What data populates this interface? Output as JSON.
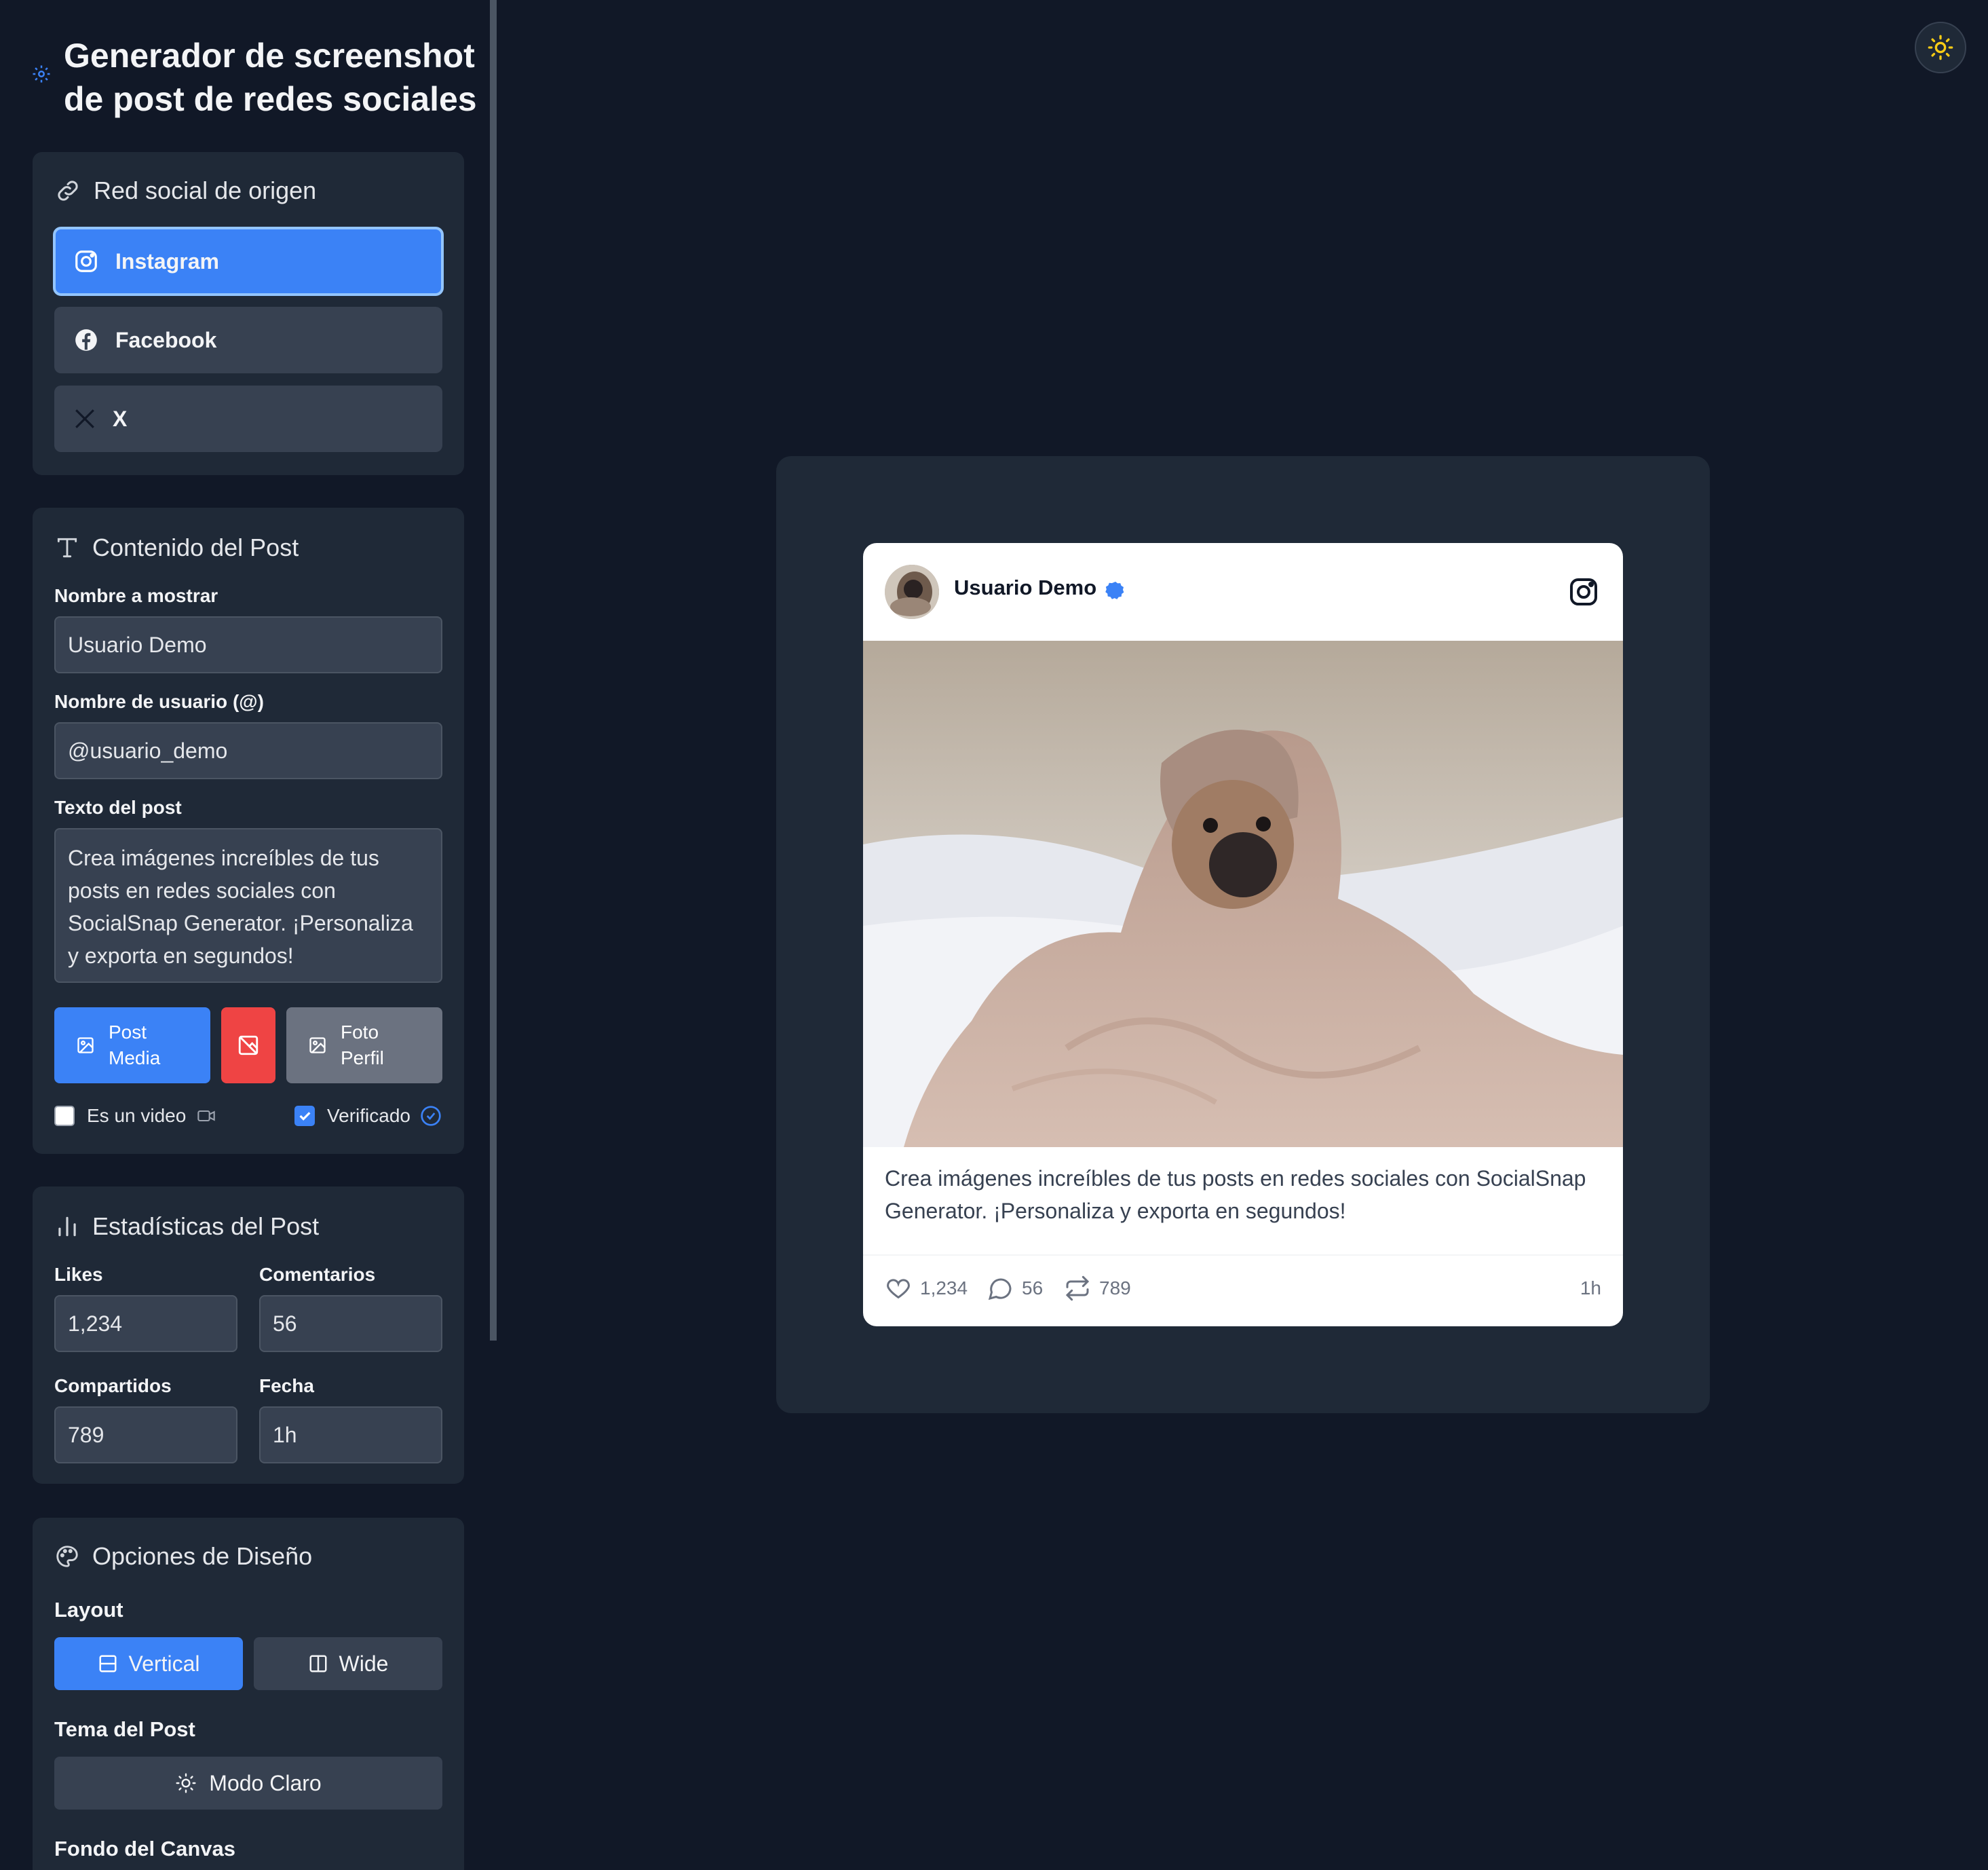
{
  "app": {
    "title": "Generador de screenshot de post de redes sociales"
  },
  "social_section": {
    "title": "Red social de origen",
    "options": [
      {
        "label": "Instagram",
        "icon": "instagram-icon",
        "selected": true
      },
      {
        "label": "Facebook",
        "icon": "facebook-icon",
        "selected": false
      },
      {
        "label": "X",
        "icon": "x-icon",
        "selected": false
      }
    ]
  },
  "content_section": {
    "title": "Contenido del Post",
    "display_name_label": "Nombre a mostrar",
    "display_name_value": "Usuario Demo",
    "username_label": "Nombre de usuario (@)",
    "username_value": "@usuario_demo",
    "text_label": "Texto del post",
    "text_value": "Crea imágenes increíbles de tus posts en redes sociales con SocialSnap Generator. ¡Personaliza y exporta en segundos!",
    "post_media_line1": "Post",
    "post_media_line2": "Media",
    "profile_photo_line1": "Foto",
    "profile_photo_line2": "Perfil",
    "is_video_label": "Es un video",
    "is_video_checked": false,
    "verified_label": "Verificado",
    "verified_checked": true
  },
  "stats_section": {
    "title": "Estadísticas del Post",
    "likes_label": "Likes",
    "likes_value": "1,234",
    "comments_label": "Comentarios",
    "comments_value": "56",
    "shares_label": "Compartidos",
    "shares_value": "789",
    "date_label": "Fecha",
    "date_value": "1h"
  },
  "design_section": {
    "title": "Opciones de Diseño",
    "layout_label": "Layout",
    "layout_vertical": "Vertical",
    "layout_wide": "Wide",
    "layout_selected": "Vertical",
    "theme_label": "Tema del Post",
    "theme_button": "Modo Claro",
    "canvas_bg_label": "Fondo del Canvas"
  },
  "preview": {
    "display_name": "Usuario Demo",
    "platform_icon": "instagram-icon",
    "text": "Crea imágenes increíbles de tus posts en redes sociales con SocialSnap Generator. ¡Personaliza y exporta en segundos!",
    "likes": "1,234",
    "comments": "56",
    "shares": "789",
    "date": "1h"
  },
  "colors": {
    "background": "#111827",
    "panel": "#1f2937",
    "input": "#374151",
    "accent": "#3b82f6",
    "danger": "#ef4444",
    "muted_button": "#6b7280",
    "sun_icon": "#facc15"
  }
}
